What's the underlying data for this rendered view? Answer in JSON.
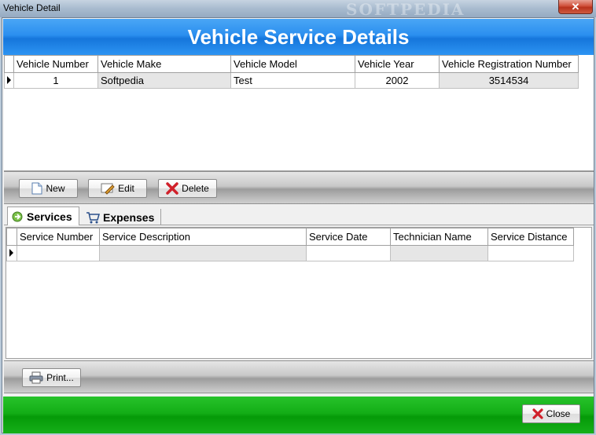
{
  "window": {
    "title": "Vehicle Detail",
    "watermark": "SOFTPEDIA",
    "close_glyph": "✕"
  },
  "header": {
    "title": "Vehicle Service Details"
  },
  "vehicle_grid": {
    "columns": [
      "Vehicle Number",
      "Vehicle Make",
      "Vehicle Model",
      "Vehicle Year",
      "Vehicle Registration Number"
    ],
    "rows": [
      {
        "number": "1",
        "make": "Softpedia",
        "model": "Test",
        "year": "2002",
        "registration": "3514534"
      }
    ]
  },
  "toolbar": {
    "new_label": "New",
    "edit_label": "Edit",
    "delete_label": "Delete"
  },
  "tabs": {
    "services_label": "Services",
    "expenses_label": "Expenses",
    "active": "Services"
  },
  "service_grid": {
    "columns": [
      "Service Number",
      "Service Description",
      "Service Date",
      "Technician Name",
      "Service Distance"
    ]
  },
  "print_bar": {
    "print_label": "Print..."
  },
  "footer": {
    "close_label": "Close"
  },
  "colors": {
    "header_blue": "#2b8fef",
    "footer_green": "#13ad16",
    "delete_red": "#d0202a"
  },
  "icons": [
    "new-document-icon",
    "edit-icon",
    "delete-x-icon",
    "services-icon",
    "cart-icon",
    "printer-icon",
    "close-x-icon"
  ]
}
